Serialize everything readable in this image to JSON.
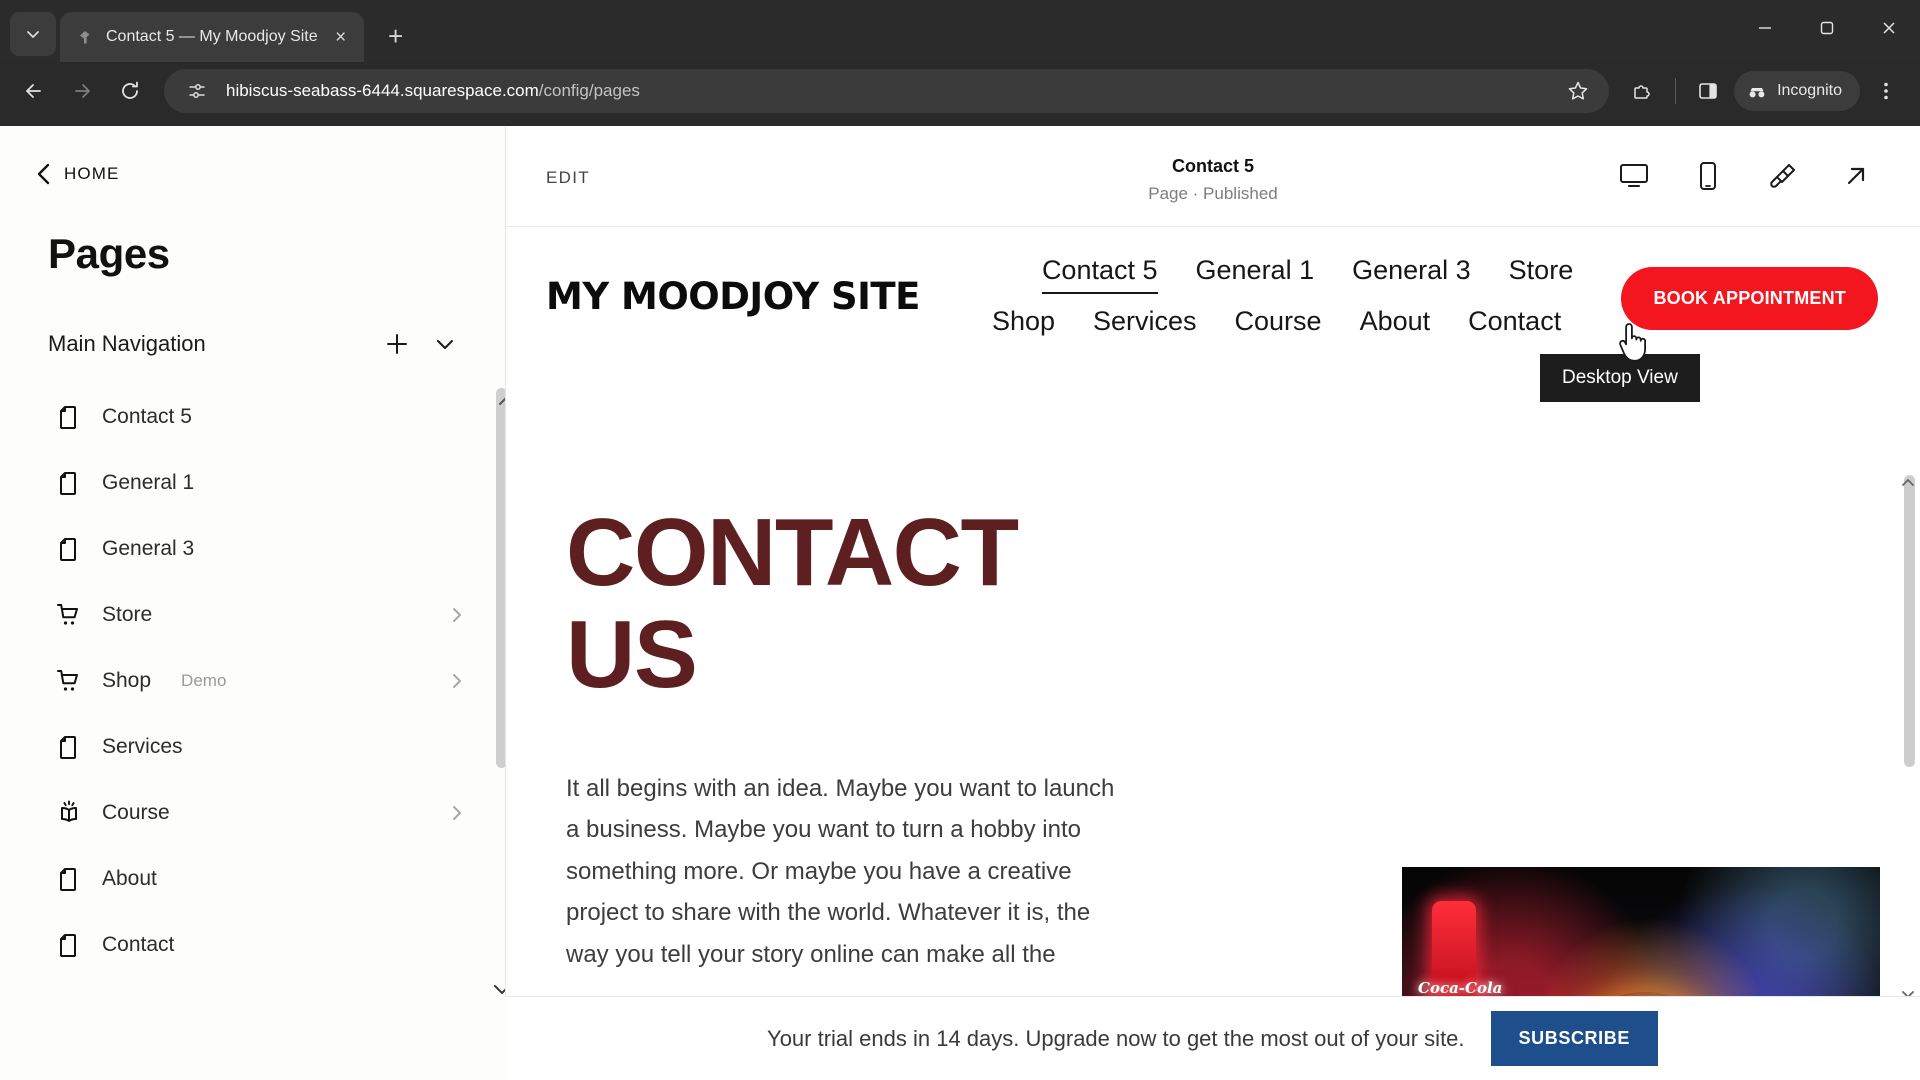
{
  "browser": {
    "tab": {
      "title": "Contact 5 — My Moodjoy Site",
      "favicon_name": "squarespace-favicon",
      "close_label": "×"
    },
    "newtab_label": "+",
    "tab_list_label": "⌄",
    "window_controls": {
      "minimize": "—",
      "maximize": "▢",
      "close": "✕"
    },
    "url": {
      "host": "hibiscus-seabass-6444.squarespace.com",
      "path": "/config/pages"
    },
    "incognito_label": "Incognito",
    "icons": {
      "back": "back-arrow-icon",
      "forward": "forward-arrow-icon",
      "reload": "reload-icon",
      "site_info": "site-settings-icon",
      "bookmark": "star-icon",
      "extensions": "extensions-icon",
      "side_panel": "side-panel-icon",
      "menu": "three-dot-menu-icon"
    }
  },
  "sidebar": {
    "home_label": "HOME",
    "title": "Pages",
    "section": {
      "title": "Main Navigation",
      "add_label": "+",
      "collapse_label": "⌄"
    },
    "items": [
      {
        "label": "Contact 5",
        "icon": "page-icon",
        "badge": "",
        "chevron": false
      },
      {
        "label": "General 1",
        "icon": "page-icon",
        "badge": "",
        "chevron": false
      },
      {
        "label": "General 3",
        "icon": "page-icon",
        "badge": "",
        "chevron": false
      },
      {
        "label": "Store",
        "icon": "cart-icon",
        "badge": "",
        "chevron": true
      },
      {
        "label": "Shop",
        "icon": "cart-icon",
        "badge": "Demo",
        "chevron": true
      },
      {
        "label": "Services",
        "icon": "page-icon",
        "badge": "",
        "chevron": false
      },
      {
        "label": "Course",
        "icon": "book-icon",
        "badge": "",
        "chevron": true
      },
      {
        "label": "About",
        "icon": "page-icon",
        "badge": "",
        "chevron": false
      },
      {
        "label": "Contact",
        "icon": "page-icon",
        "badge": "",
        "chevron": false
      }
    ]
  },
  "topbar": {
    "edit_label": "EDIT",
    "page_name": "Contact 5",
    "page_status": "Page · Published",
    "actions": [
      {
        "name": "desktop-view-icon",
        "label": "Desktop View"
      },
      {
        "name": "mobile-view-icon",
        "label": "Mobile View"
      },
      {
        "name": "paintbrush-icon",
        "label": "Site Styles"
      },
      {
        "name": "open-external-icon",
        "label": "Open in new tab"
      }
    ],
    "tooltip": "Desktop View"
  },
  "site": {
    "logo": "MY MOODJOY SITE",
    "nav_row1": [
      "Contact 5",
      "General 1",
      "General 3",
      "Store"
    ],
    "nav_row2": [
      "Shop",
      "Services",
      "Course",
      "About",
      "Contact"
    ],
    "active_nav": "Contact 5",
    "cta_label": "BOOK APPOINTMENT",
    "cta_color": "#f4161f",
    "hero_title_line1": "CONTACT",
    "hero_title_line2": "US",
    "hero_title_color": "#5d1f1f",
    "hero_body": "It all begins with an idea. Maybe you want to launch a business. Maybe you want to turn a hobby into something more. Or maybe you have a creative project to share with the world. Whatever it is, the way you tell your story online can make all the",
    "image_caption": "Coca-Cola"
  },
  "trial_banner": {
    "text": "Your trial ends in 14 days. Upgrade now to get the most out of your site.",
    "button_label": "SUBSCRIBE",
    "button_color": "#1f4e8c"
  }
}
